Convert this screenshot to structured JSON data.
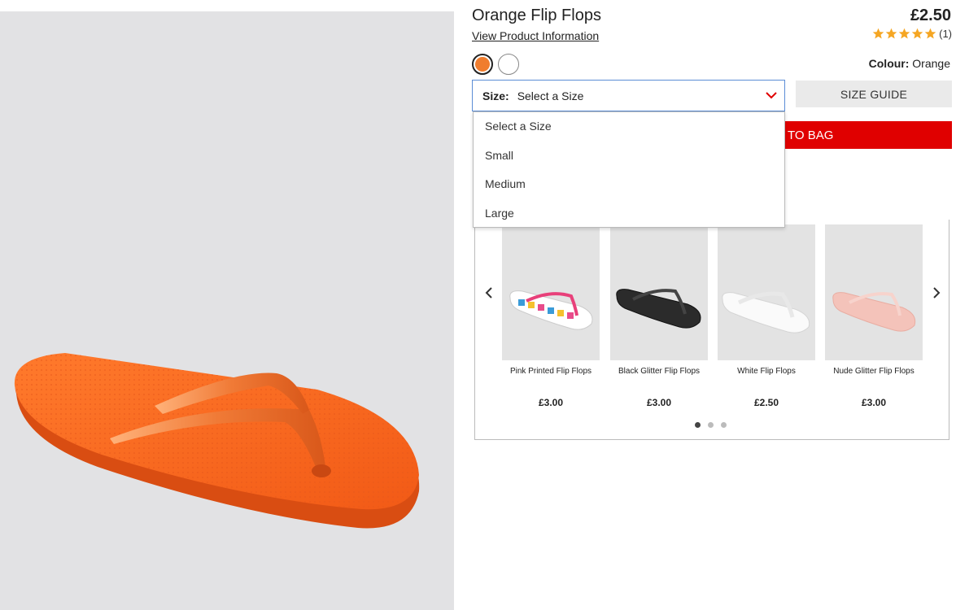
{
  "product": {
    "title": "Orange Flip Flops",
    "price": "£2.50",
    "info_link": "View Product Information",
    "rating_count": "(1)",
    "colour_label": "Colour:",
    "colour_value": "Orange"
  },
  "colors": {
    "orange": "#f07d2e",
    "accent_red": "#e00000",
    "star": "#f5a623"
  },
  "size": {
    "label": "Size:",
    "value": "Select a Size",
    "options": [
      "Select a Size",
      "Small",
      "Medium",
      "Large"
    ]
  },
  "buttons": {
    "size_guide": "SIZE GUIDE",
    "add_to_bag": "TO BAG"
  },
  "carousel": {
    "items": [
      {
        "name": "Pink Printed Flip Flops",
        "price": "£3.00"
      },
      {
        "name": "Black Glitter Flip Flops",
        "price": "£3.00"
      },
      {
        "name": "White Flip Flops",
        "price": "£2.50"
      },
      {
        "name": "Nude Glitter Flip Flops",
        "price": "£3.00"
      }
    ]
  },
  "icons": {
    "prev": "chevron-left-icon",
    "next": "chevron-right-icon",
    "dropdown": "chevron-down-icon",
    "star": "star-icon"
  }
}
